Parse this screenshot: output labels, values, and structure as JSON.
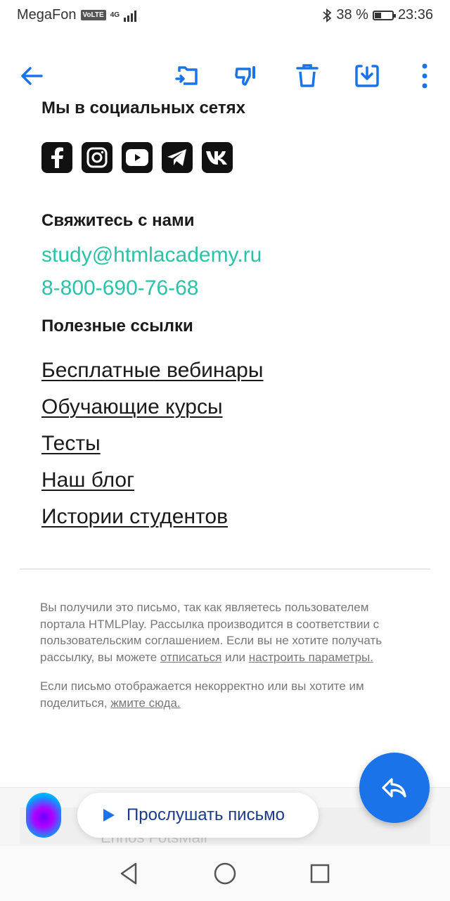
{
  "status_bar": {
    "carrier": "MegaFon",
    "volte": "VoLTE",
    "network": "4G",
    "battery": "38 %",
    "battery_level": 0.38,
    "time": "23:36"
  },
  "toolbar": {
    "icons": [
      "back-arrow-icon",
      "move-to-folder-icon",
      "thumbs-down-icon",
      "trash-icon",
      "download-icon",
      "more-vertical-icon"
    ],
    "accent_color": "#1a73e8"
  },
  "social": {
    "title": "Мы в социальных сетях",
    "networks": [
      "facebook-icon",
      "instagram-icon",
      "youtube-icon",
      "telegram-icon",
      "vk-icon"
    ]
  },
  "contact": {
    "title": "Свяжитесь с нами",
    "email": "study@htmlacademy.ru",
    "phone": "8-800-690-76-68",
    "link_color": "#2bc3a8"
  },
  "useful": {
    "title": "Полезные ссылки",
    "links": [
      "Бесплатные вебинары",
      "Обучающие курсы",
      "Тесты",
      "Наш блог",
      "Истории студентов"
    ]
  },
  "footer": {
    "p1_text": "Вы получили это письмо, так как являетесь пользователем портала HTMLPlay. Рассылка производится в соответствии с пользовательским соглашением. Если вы не хотите получать рассылку, вы можете ",
    "unsubscribe": "отписаться",
    "or": " или ",
    "settings": "настроить параметры.",
    "p2_text": "Если письмо отображается некорректно или вы хотите им поделиться, ",
    "click_here": "жмите сюда."
  },
  "bottom": {
    "listen_label": "Прослушать письмо",
    "ghost_text": "Ennos FotsMail"
  },
  "nav": {
    "icons": [
      "back-triangle-icon",
      "home-circle-icon",
      "recents-square-icon"
    ]
  }
}
